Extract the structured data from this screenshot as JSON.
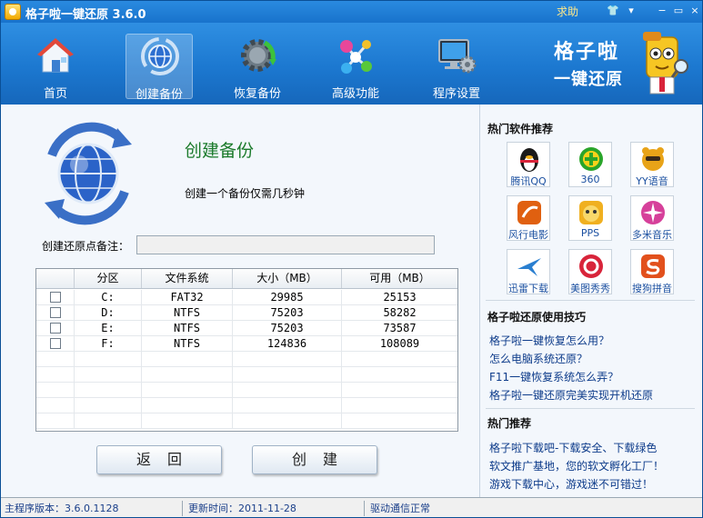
{
  "window": {
    "title": "格子啦一键还原 3.6.0",
    "help": "求助",
    "skin_glyph": "👕",
    "menu_glyph": "▾",
    "min_glyph": "−",
    "max_glyph": "▭",
    "close_glyph": "×"
  },
  "toolbar": {
    "items": [
      {
        "label": "首页",
        "icon": "house-icon"
      },
      {
        "label": "创建备份",
        "icon": "globe-backup-icon"
      },
      {
        "label": "恢复备份",
        "icon": "gear-restore-icon"
      },
      {
        "label": "高级功能",
        "icon": "molecule-icon"
      },
      {
        "label": "程序设置",
        "icon": "monitor-gear-icon"
      }
    ],
    "brand_line1": "格子啦",
    "brand_line2": "一键还原"
  },
  "main": {
    "title": "创建备份",
    "description": "创建一个备份仅需几秒钟",
    "note_label": "创建还原点备注：",
    "note_value": "",
    "table": {
      "headers": [
        "分区",
        "文件系统",
        "大小（MB）",
        "可用（MB）"
      ],
      "rows": [
        {
          "partition": "C:",
          "fs": "FAT32",
          "size": "29985",
          "free": "25153"
        },
        {
          "partition": "D:",
          "fs": "NTFS",
          "size": "75203",
          "free": "58282"
        },
        {
          "partition": "E:",
          "fs": "NTFS",
          "size": "75203",
          "free": "73587"
        },
        {
          "partition": "F:",
          "fs": "NTFS",
          "size": "124836",
          "free": "108089"
        }
      ]
    },
    "back_label": "返回",
    "create_label": "创建"
  },
  "side": {
    "hot_software_title": "热门软件推荐",
    "apps": [
      {
        "name": "腾讯QQ",
        "color": "#1a1a1a"
      },
      {
        "name": "360",
        "color": "#2aa52a"
      },
      {
        "name": "YY语音",
        "color": "#e8a318"
      },
      {
        "name": "风行电影",
        "color": "#e06010"
      },
      {
        "name": "PPS",
        "color": "#f0b020"
      },
      {
        "name": "多米音乐",
        "color": "#d6409a"
      },
      {
        "name": "迅雷下载",
        "color": "#2a7fd0"
      },
      {
        "name": "美图秀秀",
        "color": "#d8243a"
      },
      {
        "name": "搜狗拼音",
        "color": "#e2501c"
      }
    ],
    "tips_title": "格子啦还原使用技巧",
    "tips": [
      "格子啦一键恢复怎么用？",
      "怎么电脑系统还原？",
      "F11一键恢复系统怎么弄？",
      "格子啦一键还原完美实现开机还原"
    ],
    "hot_title": "热门推荐",
    "hot_links": [
      "格子啦下载吧-下载安全、下载绿色",
      "软文推广基地，您的软文孵化工厂！",
      "游戏下载中心，游戏迷不可错过！"
    ]
  },
  "status": {
    "version": "主程序版本：3.6.0.1128",
    "updated": "更新时间：2011-11-28",
    "driver": "驱动通信正常"
  }
}
